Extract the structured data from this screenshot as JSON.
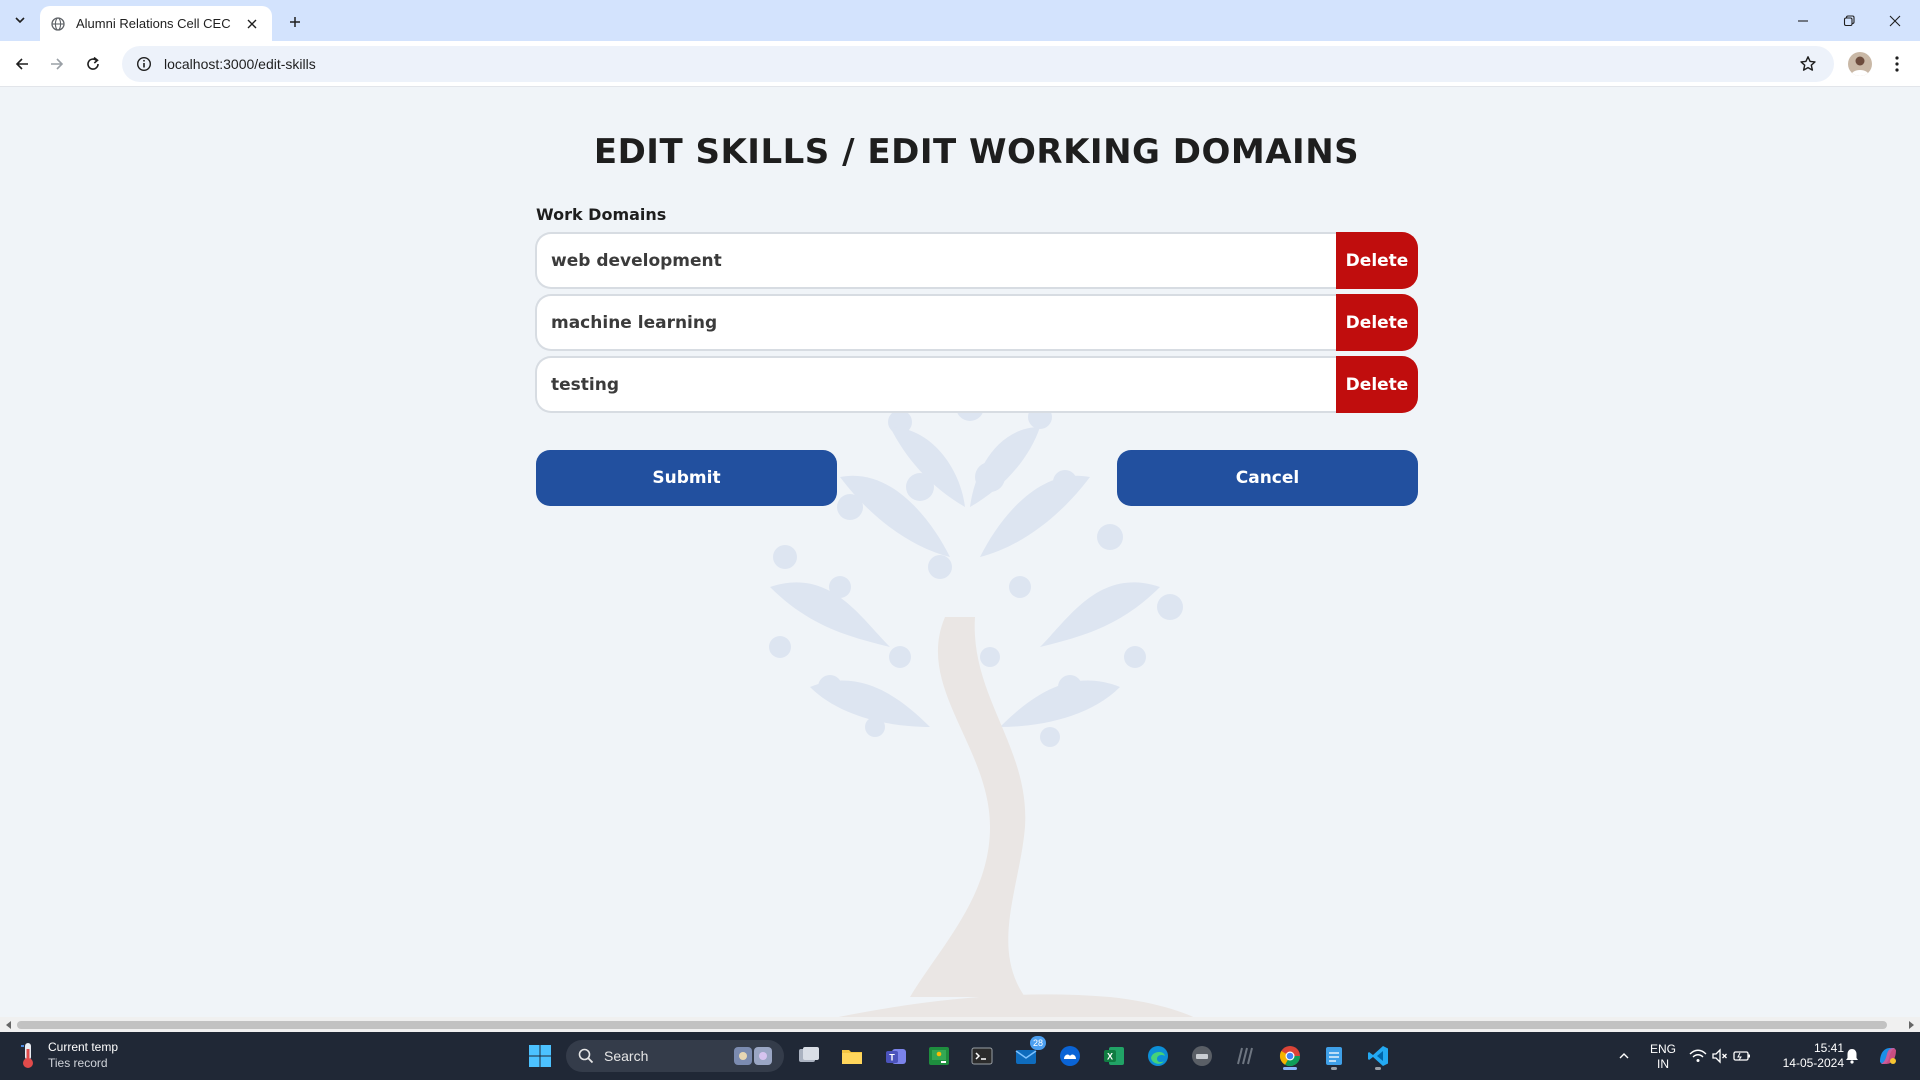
{
  "browser": {
    "tab_title": "Alumni Relations Cell CEC",
    "url": "localhost:3000/edit-skills"
  },
  "page": {
    "heading": "EDIT SKILLS / EDIT WORKING DOMAINS",
    "section_label": "Work Domains",
    "domains": [
      {
        "value": "web development",
        "delete_label": "Delete"
      },
      {
        "value": "machine learning",
        "delete_label": "Delete"
      },
      {
        "value": "testing",
        "delete_label": "Delete"
      }
    ],
    "submit_label": "Submit",
    "cancel_label": "Cancel"
  },
  "colors": {
    "primary": "#22509f",
    "danger": "#c00d0d",
    "background": "#f0f4f8",
    "text": "#1e1e1e"
  },
  "taskbar": {
    "weather_title": "Current temp",
    "weather_subtitle": "Ties record",
    "search_label": "Search",
    "mail_badge": "28",
    "language_line1": "ENG",
    "language_line2": "IN",
    "time": "15:41",
    "date": "14-05-2024"
  }
}
